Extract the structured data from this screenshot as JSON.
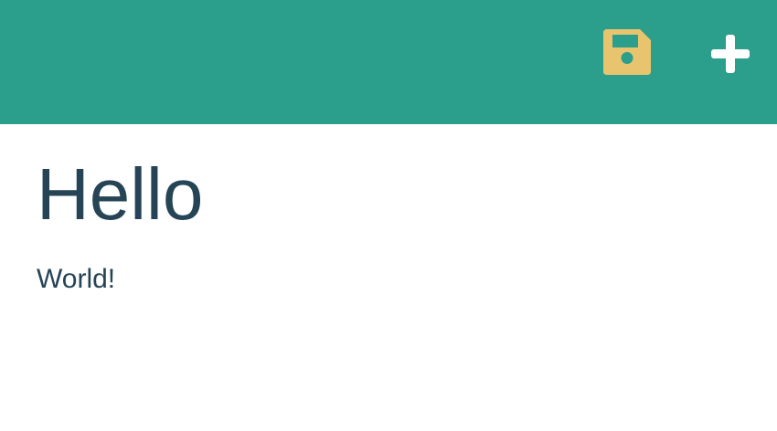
{
  "theme": {
    "header_background": "#2b9e8c",
    "text_color": "#254455",
    "save_icon_color": "#e8c46e",
    "add_icon_color": "#ffffff",
    "page_background": "#ffffff"
  },
  "toolbar": {
    "actions": [
      {
        "name": "save",
        "icon": "floppy-disk-icon"
      },
      {
        "name": "add",
        "icon": "plus-icon"
      }
    ]
  },
  "main": {
    "title": "Hello",
    "body": "World!"
  }
}
